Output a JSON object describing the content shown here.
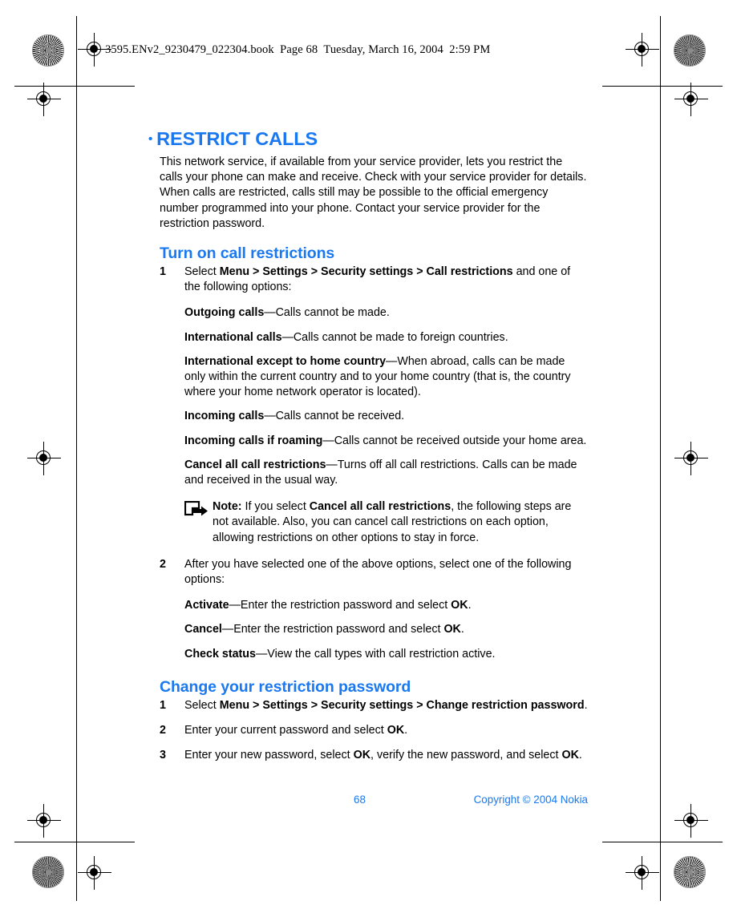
{
  "page": {
    "running_header": "3595.ENv2_9230479_022304.book  Page 68  Tuesday, March 16, 2004  2:59 PM",
    "accent_color": "#1a78f0",
    "text_color": "#000000",
    "background_color": "#ffffff"
  },
  "chapter": {
    "bullet": "•",
    "title": "RESTRICT CALLS",
    "intro": "This network service, if available from your service provider, lets you restrict the calls your phone can make and receive. Check with your service provider for details. When calls are restricted, calls still may be possible to the official emergency number programmed into your phone. Contact your service provider for the restriction password."
  },
  "section_turn_on": {
    "title": "Turn on call restrictions",
    "step1": {
      "num": "1",
      "lead": "Select ",
      "path": "Menu > Settings > Security settings > Call restrictions",
      "tail": " and one of the following options:"
    },
    "options": [
      {
        "term": "Outgoing calls",
        "dash": "—",
        "desc": "Calls cannot be made."
      },
      {
        "term": "International calls",
        "dash": "—",
        "desc": "Calls cannot be made to foreign countries."
      },
      {
        "term": "International except to home country",
        "dash": "—",
        "desc": "When abroad, calls can be made only within the current country and to your home country (that is, the country where your home network operator is located)."
      },
      {
        "term": "Incoming calls",
        "dash": "—",
        "desc": "Calls cannot be received."
      },
      {
        "term": "Incoming calls if roaming",
        "dash": "—",
        "desc": "Calls cannot be received outside your home area."
      },
      {
        "term": "Cancel all call restrictions",
        "dash": "—",
        "desc": "Turns off all call restrictions. Calls can be made and received in the usual way."
      }
    ],
    "note": {
      "icon": "note-arrow-icon",
      "label": "Note:",
      "text_before": " If you select ",
      "emphasis": "Cancel all call restrictions",
      "text_after": ", the following steps are not available. Also, you can cancel call restrictions on each option, allowing restrictions on other options to stay in force."
    },
    "step2": {
      "num": "2",
      "text": "After you have selected one of the above options, select one of the following options:"
    },
    "actions": [
      {
        "term": "Activate",
        "dash": "—",
        "before": "Enter the restriction password and select ",
        "key": "OK",
        "after": "."
      },
      {
        "term": "Cancel",
        "dash": "—",
        "before": "Enter the restriction password and select ",
        "key": "OK",
        "after": "."
      },
      {
        "term": "Check status",
        "dash": "—",
        "before": "View the call types with call restriction active.",
        "key": "",
        "after": ""
      }
    ]
  },
  "section_change_password": {
    "title": "Change your restriction password",
    "steps": [
      {
        "num": "1",
        "lead": "Select ",
        "path": "Menu > Settings > Security settings > Change restriction password",
        "tail": "."
      },
      {
        "num": "2",
        "lead": "Enter your current password and select ",
        "path": "OK",
        "tail": "."
      },
      {
        "num": "3",
        "lead": "Enter your new password, select ",
        "path": "OK",
        "tail": ", verify the new password, and select ",
        "path2": "OK",
        "tail2": "."
      }
    ]
  },
  "footer": {
    "page_number": "68",
    "copyright": "Copyright © 2004 Nokia"
  }
}
